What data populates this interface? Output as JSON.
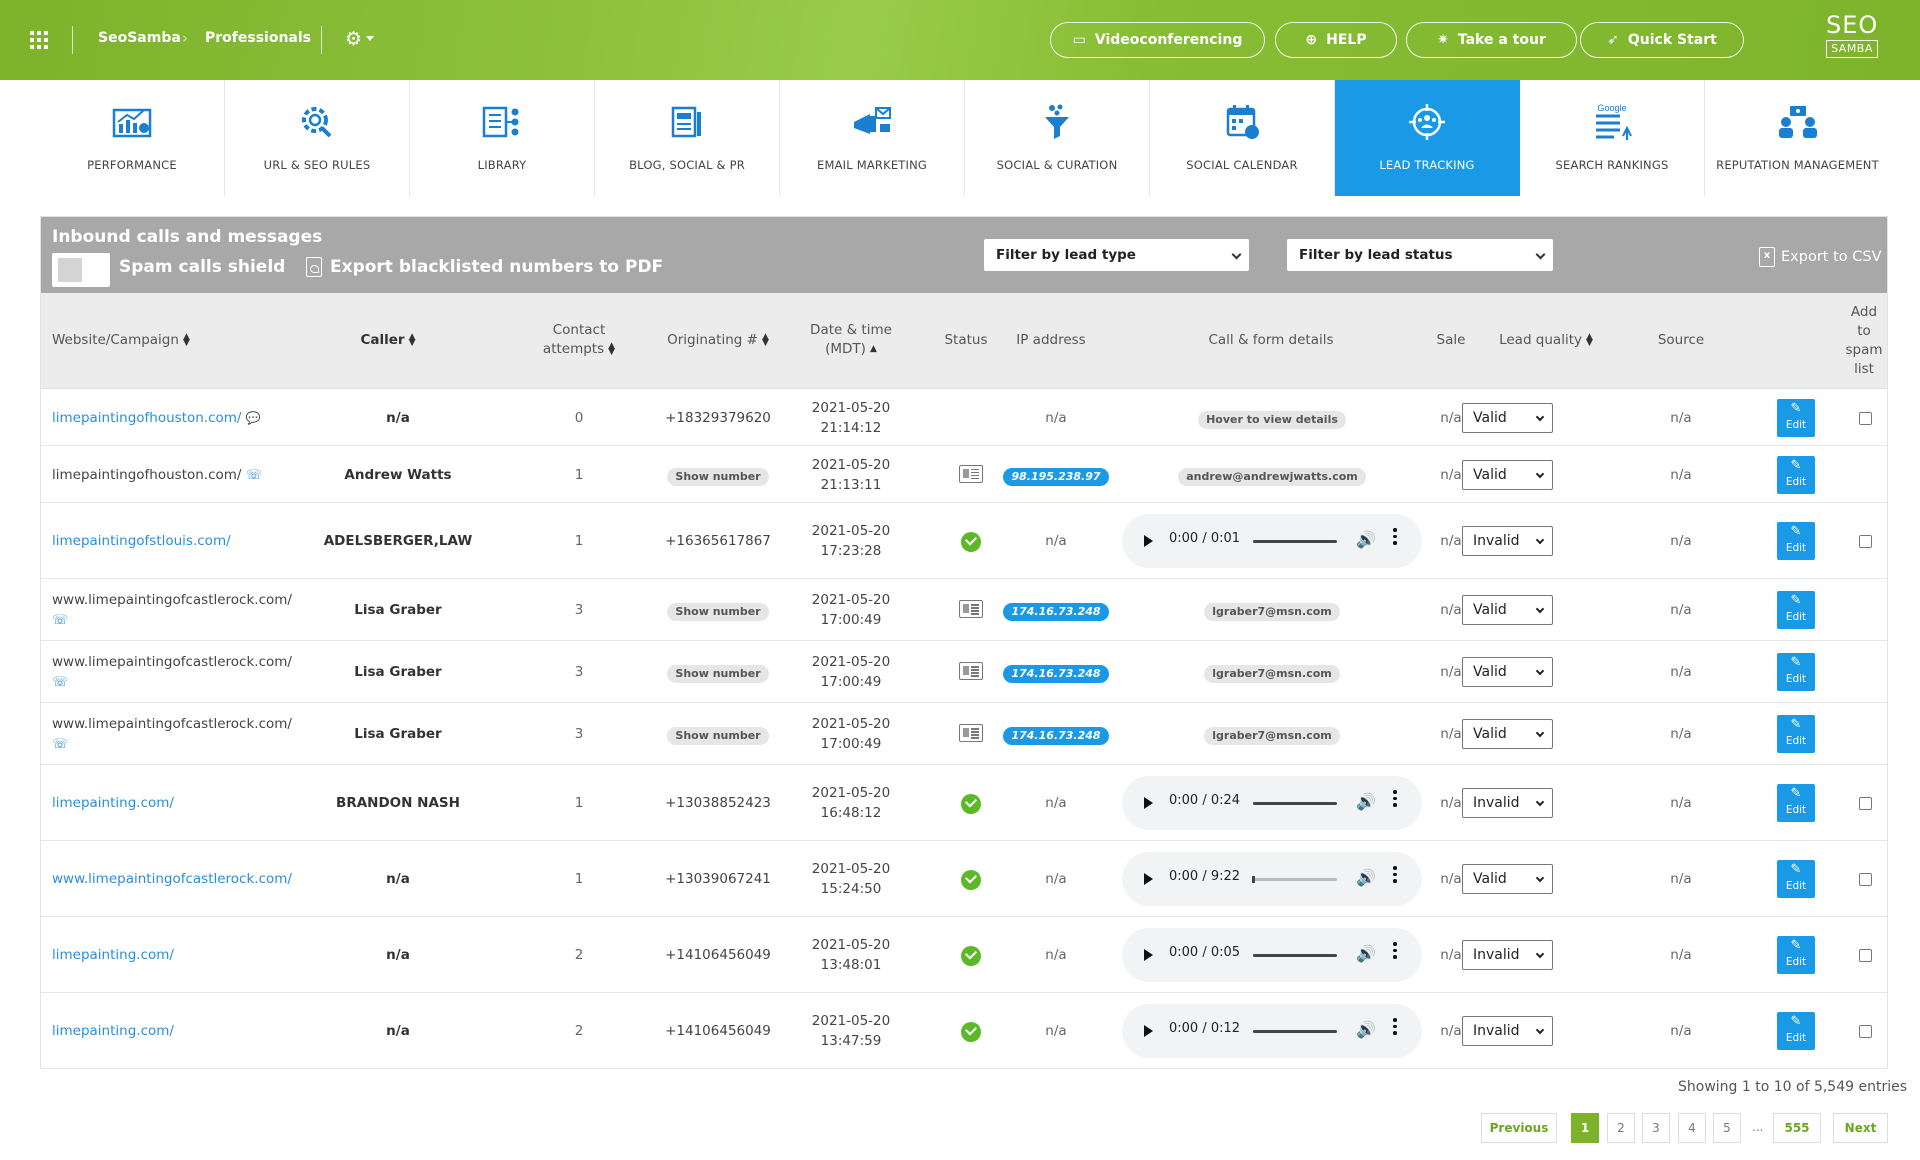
{
  "breadcrumb": [
    "SeoSamba",
    "Professionals"
  ],
  "top_buttons": [
    "Videoconferencing",
    "HELP",
    "Take a tour",
    "Quick Start"
  ],
  "logo": {
    "line1": "SEO",
    "line2": "SAMBA"
  },
  "modules": [
    {
      "label": "PERFORMANCE",
      "icon": "performance-chart-icon"
    },
    {
      "label": "URL & SEO RULES",
      "icon": "url-gear-icon"
    },
    {
      "label": "LIBRARY",
      "icon": "library-icon"
    },
    {
      "label": "BLOG, SOCIAL & PR",
      "icon": "blog-icon"
    },
    {
      "label": "EMAIL MARKETING",
      "icon": "email-megaphone-icon"
    },
    {
      "label": "SOCIAL & CURATION",
      "icon": "curation-funnel-icon"
    },
    {
      "label": "SOCIAL CALENDAR",
      "icon": "calendar-icon"
    },
    {
      "label": "LEAD TRACKING",
      "icon": "lead-tracking-icon",
      "active": true
    },
    {
      "label": "SEARCH RANKINGS",
      "icon": "google-rankings-icon"
    },
    {
      "label": "REPUTATION MANAGEMENT",
      "icon": "reputation-people-icon"
    }
  ],
  "panel": {
    "title": "Inbound calls and messages",
    "spam_shield_label": "Spam calls shield",
    "export_pdf_label": "Export blacklisted numbers to PDF",
    "filter_type": "Filter by lead type",
    "filter_status": "Filter by lead status",
    "export_csv_label": "Export to CSV"
  },
  "columns": {
    "website": "Website/Campaign",
    "caller": "Caller",
    "contact1": "Contact",
    "contact2": "attempts",
    "originating": "Originating #",
    "date1": "Date & time",
    "date2": "(MDT)",
    "status": "Status",
    "ip": "IP address",
    "details": "Call & form details",
    "sale": "Sale",
    "quality": "Lead quality",
    "source": "Source",
    "spam1": "Add",
    "spam2": "to",
    "spam3": "spam",
    "spam4": "list"
  },
  "rows": [
    {
      "website": "limepaintingofhouston.com/",
      "web_link": true,
      "caller": "n/a",
      "attempts": "0",
      "orig": "+18329379620",
      "orig_tag": false,
      "date": "2021-05-20",
      "time": "21:14:12",
      "status": "",
      "ip": "n/a",
      "details_type": "tag",
      "details": "Hover to view details",
      "sale": "n/a",
      "quality": "Valid",
      "source": "n/a",
      "edit": "Edit",
      "checkbox": true
    },
    {
      "website": "limepaintingofhouston.com/",
      "web_link": false,
      "caller": "Andrew Watts",
      "attempts": "1",
      "orig": "Show number",
      "orig_tag": true,
      "date": "2021-05-20",
      "time": "21:13:11",
      "status": "form",
      "ip": "98.195.238.97",
      "details_type": "tag",
      "details": "andrew@andrewjwatts.com",
      "sale": "n/a",
      "quality": "Valid",
      "source": "n/a",
      "edit": "Edit",
      "checkbox": false
    },
    {
      "website": "limepaintingofstlouis.com/",
      "web_link": true,
      "caller": "ADELSBERGER,LAW",
      "attempts": "1",
      "orig": "+16365617867",
      "orig_tag": false,
      "date": "2021-05-20",
      "time": "17:23:28",
      "status": "check",
      "ip": "n/a",
      "details_type": "audio",
      "details": "0:00 / 0:01",
      "sale": "n/a",
      "quality": "Invalid",
      "source": "n/a",
      "edit": "Edit",
      "checkbox": true
    },
    {
      "website": "www.limepaintingofcastlerock.com/",
      "web_link": false,
      "caller": "Lisa Graber",
      "attempts": "3",
      "orig": "Show number",
      "orig_tag": true,
      "date": "2021-05-20",
      "time": "17:00:49",
      "status": "form",
      "ip": "174.16.73.248",
      "details_type": "tag",
      "details": "lgraber7@msn.com",
      "sale": "n/a",
      "quality": "Valid",
      "source": "n/a",
      "edit": "Edit",
      "checkbox": false
    },
    {
      "website": "www.limepaintingofcastlerock.com/",
      "web_link": false,
      "caller": "Lisa Graber",
      "attempts": "3",
      "orig": "Show number",
      "orig_tag": true,
      "date": "2021-05-20",
      "time": "17:00:49",
      "status": "form",
      "ip": "174.16.73.248",
      "details_type": "tag",
      "details": "lgraber7@msn.com",
      "sale": "n/a",
      "quality": "Valid",
      "source": "n/a",
      "edit": "Edit",
      "checkbox": false
    },
    {
      "website": "www.limepaintingofcastlerock.com/",
      "web_link": false,
      "caller": "Lisa Graber",
      "attempts": "3",
      "orig": "Show number",
      "orig_tag": true,
      "date": "2021-05-20",
      "time": "17:00:49",
      "status": "form",
      "ip": "174.16.73.248",
      "details_type": "tag",
      "details": "lgraber7@msn.com",
      "sale": "n/a",
      "quality": "Valid",
      "source": "n/a",
      "edit": "Edit",
      "checkbox": false
    },
    {
      "website": "limepainting.com/",
      "web_link": true,
      "caller": "BRANDON NASH",
      "attempts": "1",
      "orig": "+13038852423",
      "orig_tag": false,
      "date": "2021-05-20",
      "time": "16:48:12",
      "status": "check",
      "ip": "n/a",
      "details_type": "audio",
      "details": "0:00 / 0:24",
      "sale": "n/a",
      "quality": "Invalid",
      "source": "n/a",
      "edit": "Edit",
      "checkbox": true
    },
    {
      "website": "www.limepaintingofcastlerock.com/",
      "web_link": true,
      "caller": "n/a",
      "attempts": "1",
      "orig": "+13039067241",
      "orig_tag": false,
      "date": "2021-05-20",
      "time": "15:24:50",
      "status": "check",
      "ip": "n/a",
      "details_type": "audio",
      "details": "0:00 / 9:22",
      "sale": "n/a",
      "quality": "Valid",
      "source": "n/a",
      "edit": "Edit",
      "checkbox": true
    },
    {
      "website": "limepainting.com/",
      "web_link": true,
      "caller": "n/a",
      "attempts": "2",
      "orig": "+14106456049",
      "orig_tag": false,
      "date": "2021-05-20",
      "time": "13:48:01",
      "status": "check",
      "ip": "n/a",
      "details_type": "audio",
      "details": "0:00 / 0:05",
      "sale": "n/a",
      "quality": "Invalid",
      "source": "n/a",
      "edit": "Edit",
      "checkbox": true
    },
    {
      "website": "limepainting.com/",
      "web_link": true,
      "caller": "n/a",
      "attempts": "2",
      "orig": "+14106456049",
      "orig_tag": false,
      "date": "2021-05-20",
      "time": "13:47:59",
      "status": "check",
      "ip": "n/a",
      "details_type": "audio",
      "details": "0:00 / 0:12",
      "sale": "n/a",
      "quality": "Invalid",
      "source": "n/a",
      "edit": "Edit",
      "checkbox": true
    }
  ],
  "footer": {
    "showing": "Showing 1 to 10 of 5,549 entries",
    "previous": "Previous",
    "pages": [
      "1",
      "2",
      "3",
      "4",
      "5"
    ],
    "ellipsis": "...",
    "last_page": "555",
    "next": "Next"
  },
  "colors": {
    "brand_green": "#7cb32a",
    "accent_blue": "#1a9ae6",
    "header_gray": "#a8a8a8",
    "status_green": "#5cb829"
  }
}
